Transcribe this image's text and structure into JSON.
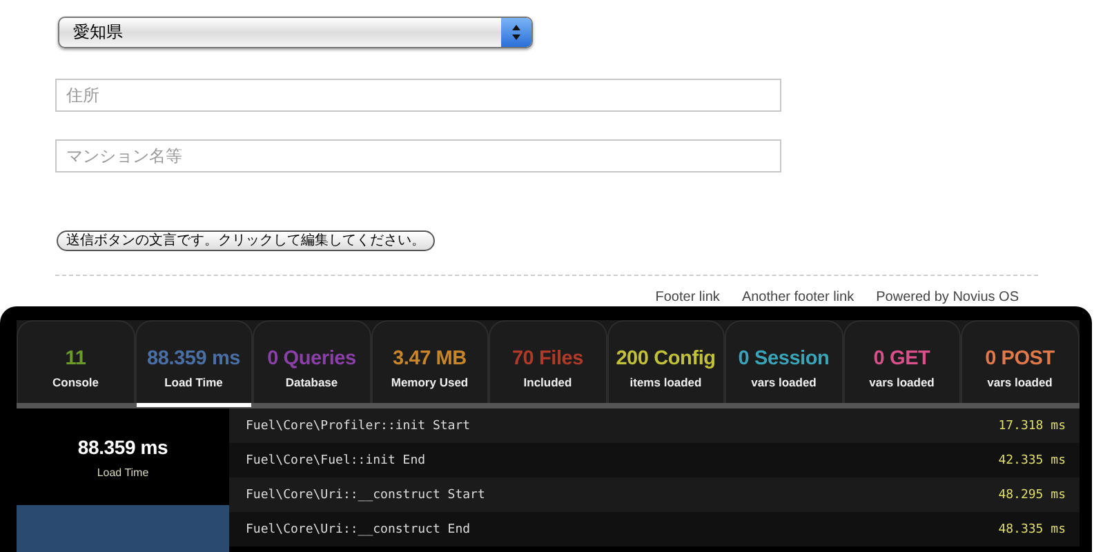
{
  "form": {
    "prefecture": {
      "value": "愛知県"
    },
    "fields": [
      {
        "placeholder": "住所"
      },
      {
        "placeholder": "マンション名等"
      }
    ],
    "submit": {
      "label": "送信ボタンの文言です。クリックして編集してください。"
    }
  },
  "footer": {
    "links": [
      "Footer link",
      "Another footer link",
      "Powered by Novius OS"
    ]
  },
  "profiler": {
    "tabs": [
      {
        "value": "11",
        "label": "Console",
        "color": "#6a9a2a",
        "selected": false
      },
      {
        "value": "88.359 ms",
        "label": "Load Time",
        "color": "#4a6fa5",
        "selected": true
      },
      {
        "value": "0 Queries",
        "label": "Database",
        "color": "#8b3fa8",
        "selected": false
      },
      {
        "value": "3.47 MB",
        "label": "Memory Used",
        "color": "#c8852a",
        "selected": false
      },
      {
        "value": "70 Files",
        "label": "Included",
        "color": "#b03a2a",
        "selected": false
      },
      {
        "value": "200 Config",
        "label": "items loaded",
        "color": "#c2c23a",
        "selected": false
      },
      {
        "value": "0 Session",
        "label": "vars loaded",
        "color": "#3aa5b8",
        "selected": false
      },
      {
        "value": "0 GET",
        "label": "vars loaded",
        "color": "#d9508a",
        "selected": false
      },
      {
        "value": "0 POST",
        "label": "vars loaded",
        "color": "#e07a4a",
        "selected": false
      }
    ],
    "summary": {
      "value": "88.359 ms",
      "label": "Load Time"
    },
    "rows": [
      {
        "name": "Fuel\\Core\\Profiler::init Start",
        "time": "17.318 ms"
      },
      {
        "name": "Fuel\\Core\\Fuel::init End",
        "time": "42.335 ms"
      },
      {
        "name": "Fuel\\Core\\Uri::__construct Start",
        "time": "48.295 ms"
      },
      {
        "name": "Fuel\\Core\\Uri::__construct End",
        "time": "48.335 ms"
      }
    ]
  }
}
